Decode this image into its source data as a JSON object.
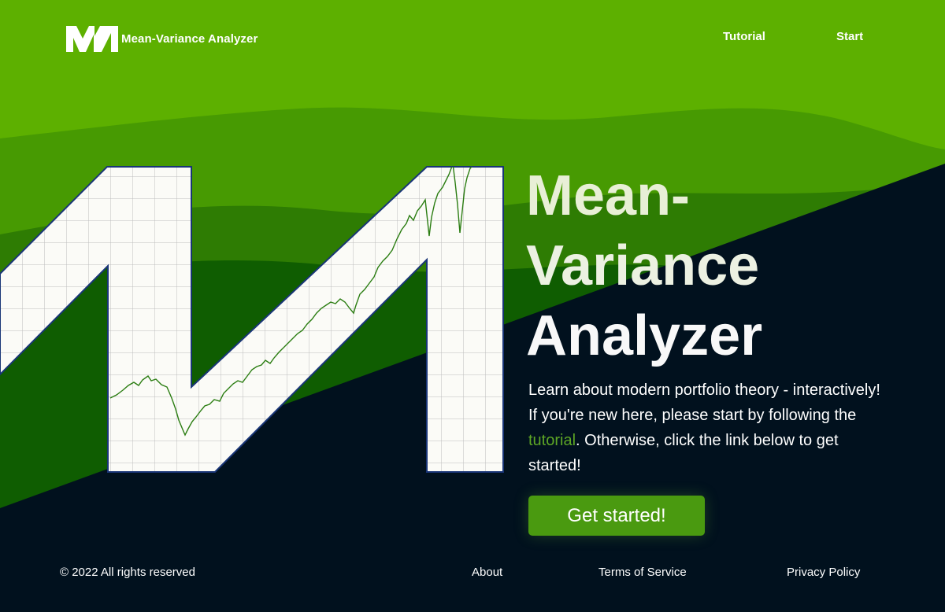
{
  "header": {
    "brand_name": "Mean-Variance Analyzer",
    "nav": [
      {
        "label": "Tutorial"
      },
      {
        "label": "Start"
      }
    ]
  },
  "hero": {
    "title_lines": [
      "Mean-",
      "Variance",
      "Analyzer"
    ],
    "intro_lines": [
      "Learn about modern portfolio theory - interactively!",
      "If you're new here, please start by following the"
    ],
    "intro_link": "tutorial",
    "intro_after_link": ". Otherwise, click the link below to get",
    "intro_last": "started!",
    "cta_label": "Get started!"
  },
  "footer": {
    "copyright": "© 2022 All rights reserved",
    "links": [
      {
        "label": "About"
      },
      {
        "label": "Terms of Service"
      },
      {
        "label": "Privacy Policy"
      }
    ]
  },
  "colors": {
    "header_green": "#5db000",
    "wave_mid_green": "#479a02",
    "wave_dark_green": "#2e7c03",
    "wave_deep_green": "#0f5d01",
    "navy": "#01111e",
    "grid_fill": "#fbfbf7",
    "grid_outline": "#193577",
    "chart_line": "#2b7d12",
    "cta_green": "#4a9a10",
    "link_green": "#5da625"
  },
  "icons": [
    "mva-logo-icon",
    "mva-grid-logo-graphic",
    "price-chart-line"
  ]
}
